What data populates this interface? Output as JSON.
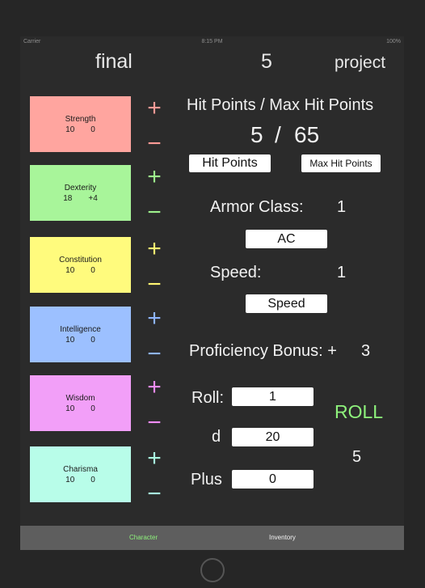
{
  "status_bar": {
    "carrier": "Carrier",
    "time": "8:15 PM",
    "battery": "100%"
  },
  "header": {
    "left": "final",
    "center": "5",
    "right": "project"
  },
  "stats": [
    {
      "name": "Strength",
      "score": "10",
      "modifier": "0",
      "color": "#ffa59f",
      "plus_color": "#ff9a96",
      "minus_color": "#ff9a96"
    },
    {
      "name": "Dexterity",
      "score": "18",
      "modifier": "+4",
      "color": "#a8f59a",
      "plus_color": "#9df08c",
      "minus_color": "#9df08c"
    },
    {
      "name": "Constitution",
      "score": "10",
      "modifier": "0",
      "color": "#fffb7d",
      "plus_color": "#fff571",
      "minus_color": "#fff571"
    },
    {
      "name": "Intelligence",
      "score": "10",
      "modifier": "0",
      "color": "#9cc0ff",
      "plus_color": "#8eb5ff",
      "minus_color": "#8eb5ff"
    },
    {
      "name": "Wisdom",
      "score": "10",
      "modifier": "0",
      "color": "#f29ff8",
      "plus_color": "#f08cf6",
      "minus_color": "#f08cf6"
    },
    {
      "name": "Charisma",
      "score": "10",
      "modifier": "0",
      "color": "#b8fde9",
      "plus_color": "#a9f8e0",
      "minus_color": "#a9f8e0"
    }
  ],
  "symbols": {
    "plus": "+",
    "minus": "−"
  },
  "hit_points": {
    "title": "Hit Points / Max Hit Points",
    "current": "5",
    "separator": "/",
    "max": "65",
    "hp_button": "Hit Points",
    "max_hp_button": "Max Hit Points"
  },
  "armor": {
    "label": "Armor Class:",
    "value": "1",
    "button": "AC"
  },
  "speed": {
    "label": "Speed:",
    "value": "1",
    "button": "Speed"
  },
  "proficiency": {
    "label": "Proficiency Bonus: +",
    "value": "3"
  },
  "dice": {
    "roll_label": "Roll:",
    "roll_value": "1",
    "d_label": "d",
    "d_value": "20",
    "plus_label": "Plus",
    "plus_value": "0",
    "roll_button": "ROLL",
    "roll_button_color": "#8ef27c",
    "result": "5"
  },
  "tabs": [
    {
      "label": "Character",
      "color": "#8ef27c"
    },
    {
      "label": "Inventory",
      "color": "#f2f2f2"
    }
  ]
}
